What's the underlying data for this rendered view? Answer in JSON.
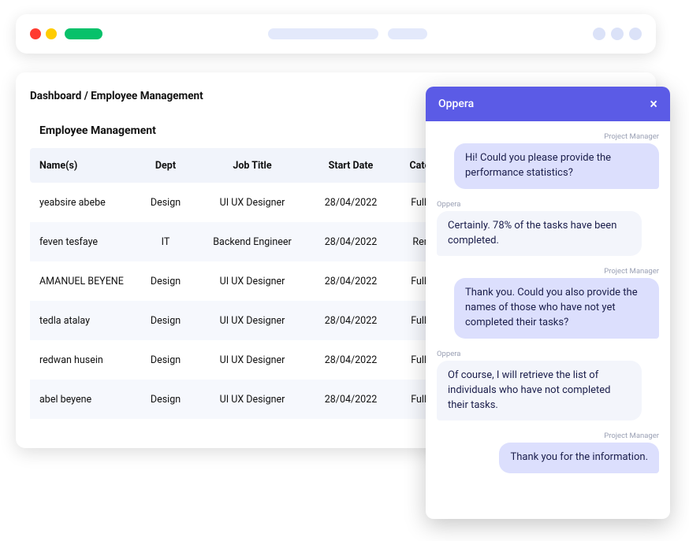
{
  "breadcrumb": "Dashboard / Employee Management",
  "page_title": "Employee Management",
  "table": {
    "headers": [
      "Name(s)",
      "Dept",
      "Job Title",
      "Start Date",
      "Category"
    ],
    "rows": [
      {
        "name": "yeabsire abebe",
        "dept": "Design",
        "title": "UI UX Designer",
        "start": "28/04/2022",
        "category": "Full time"
      },
      {
        "name": "feven tesfaye",
        "dept": "IT",
        "title": "Backend Engineer",
        "start": "28/04/2022",
        "category": "Remote"
      },
      {
        "name": "AMANUEL BEYENE",
        "dept": "Design",
        "title": "UI UX Designer",
        "start": "28/04/2022",
        "category": "Full time"
      },
      {
        "name": "tedla atalay",
        "dept": "Design",
        "title": "UI UX Designer",
        "start": "28/04/2022",
        "category": "Full time"
      },
      {
        "name": "redwan husein",
        "dept": "Design",
        "title": "UI UX Designer",
        "start": "28/04/2022",
        "category": "Full time"
      },
      {
        "name": "abel beyene",
        "dept": "Design",
        "title": "UI UX Designer",
        "start": "28/04/2022",
        "category": "Full time"
      }
    ]
  },
  "chat": {
    "title": "Oppera",
    "labels": {
      "pm": "Project Manager",
      "oppera": "Oppera"
    },
    "messages": [
      {
        "role": "pm",
        "text": "Hi! Could you please provide the performance statistics?"
      },
      {
        "role": "oppera",
        "text": "Certainly. 78% of the tasks have been completed."
      },
      {
        "role": "pm",
        "text": "Thank you. Could you also provide the names of those who have not yet completed their tasks?"
      },
      {
        "role": "oppera",
        "text": "Of course, I will retrieve the list of individuals who have not completed their tasks."
      },
      {
        "role": "pm",
        "text": "Thank you for the information."
      }
    ]
  }
}
